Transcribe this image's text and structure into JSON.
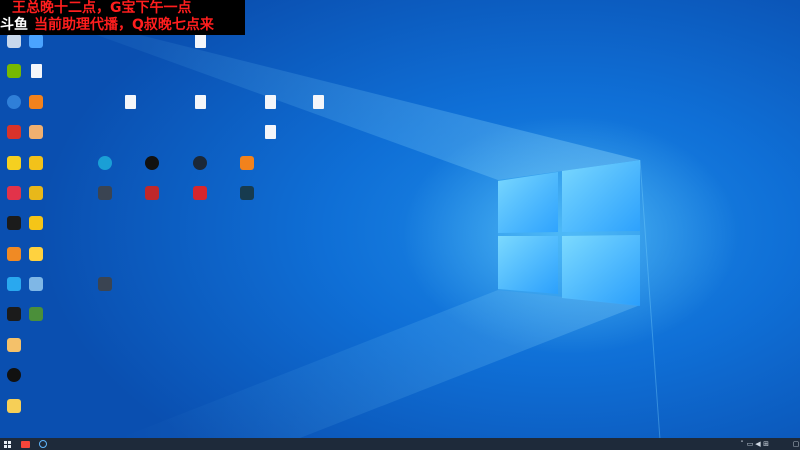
{
  "overlay": {
    "line1": "王总晚十二点，G宝下午一点",
    "badge": "斗鱼",
    "line2": "当前助理代播，Q叔晚七点来"
  },
  "desktop_icons": [
    {
      "id": "recycle-bin",
      "icon": "recycle-bin-icon",
      "color": "#c8d8ec"
    },
    {
      "id": "app-c1r1b",
      "icon": "app-icon",
      "color": "#4aa3ff"
    },
    {
      "id": "nvidia",
      "icon": "nvidia-icon",
      "color": "#76b900"
    },
    {
      "id": "file-c2r2",
      "icon": "file-icon",
      "color": "#f4f6fa"
    },
    {
      "id": "app-blue-round",
      "icon": "app-icon",
      "color": "#2f7fd8"
    },
    {
      "id": "app-orange",
      "icon": "app-icon",
      "color": "#f2821c"
    },
    {
      "id": "app-red-w",
      "icon": "app-icon",
      "color": "#d8332a"
    },
    {
      "id": "app-character",
      "icon": "app-icon",
      "color": "#f0b070"
    },
    {
      "id": "app-yellow",
      "icon": "app-icon",
      "color": "#f5d020"
    },
    {
      "id": "app-yellow-face",
      "icon": "app-icon",
      "color": "#f2c21a"
    },
    {
      "id": "app-red-square",
      "icon": "app-icon",
      "color": "#e2334a"
    },
    {
      "id": "app-yellow-square",
      "icon": "app-icon",
      "color": "#e8b81a"
    },
    {
      "id": "app-black-yellow",
      "icon": "app-icon",
      "color": "#1b1b1b"
    },
    {
      "id": "app-p-yellow",
      "icon": "app-icon",
      "color": "#f5c518"
    },
    {
      "id": "app-tiger",
      "icon": "app-icon",
      "color": "#f08a24"
    },
    {
      "id": "app-bird",
      "icon": "app-icon",
      "color": "#ffd23f"
    },
    {
      "id": "app-cloud",
      "icon": "app-icon",
      "color": "#29a8ef"
    },
    {
      "id": "app-cloud2",
      "icon": "app-icon",
      "color": "#7fb7e6"
    },
    {
      "id": "app-penguin",
      "icon": "app-icon",
      "color": "#1b1b1b"
    },
    {
      "id": "app-green-globe",
      "icon": "app-icon",
      "color": "#4b8f3a"
    },
    {
      "id": "app-anime",
      "icon": "app-icon",
      "color": "#f4c16a"
    },
    {
      "id": "app-dark-round",
      "icon": "app-icon",
      "color": "#111"
    },
    {
      "id": "folder-yellow",
      "icon": "folder-icon",
      "color": "#f6cf57"
    },
    {
      "id": "file-top-mid",
      "icon": "file-icon",
      "color": "#f4f6fa"
    },
    {
      "id": "file-r1-a",
      "icon": "file-icon",
      "color": "#f4f6fa"
    },
    {
      "id": "file-r1-b",
      "icon": "file-icon",
      "color": "#f4f6fa"
    },
    {
      "id": "file-r1-c",
      "icon": "file-icon",
      "color": "#f4f6fa"
    },
    {
      "id": "file-r1-d",
      "icon": "file-icon",
      "color": "#f4f6fa"
    },
    {
      "id": "file-r2",
      "icon": "file-icon",
      "color": "#f4f6fa"
    },
    {
      "id": "edge",
      "icon": "edge-icon",
      "color": "#1a9fd6"
    },
    {
      "id": "app-black-circle",
      "icon": "app-icon",
      "color": "#111"
    },
    {
      "id": "steam",
      "icon": "steam-icon",
      "color": "#1b2838"
    },
    {
      "id": "app-orange2",
      "icon": "app-icon",
      "color": "#f2821c"
    },
    {
      "id": "app-gun",
      "icon": "app-icon",
      "color": "#3a4452"
    },
    {
      "id": "app-red-banner",
      "icon": "app-icon",
      "color": "#c0282a"
    },
    {
      "id": "netease-music",
      "icon": "music-icon",
      "color": "#d8262c"
    },
    {
      "id": "app-teal",
      "icon": "app-icon",
      "color": "#173b4f"
    },
    {
      "id": "app-gun2",
      "icon": "app-icon",
      "color": "#3a4452"
    }
  ],
  "taskbar": {
    "start_icon": "windows-start-icon",
    "apps": [
      "douyu-icon",
      "app-icon"
    ],
    "tray": [
      "chevron-up-icon",
      "network-icon",
      "volume-icon",
      "ime-icon"
    ],
    "notif_icon": "notification-icon"
  },
  "colors": {
    "overlay_text": "#ff1e1e",
    "taskbar": "#1e2a3a"
  }
}
